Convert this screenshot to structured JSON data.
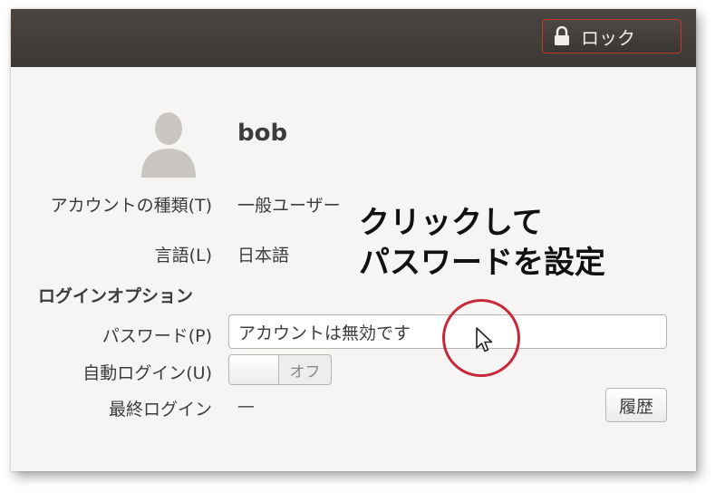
{
  "header": {
    "lock_button": {
      "label": "ロック",
      "icon": "lock-icon"
    }
  },
  "user": {
    "name": "bob",
    "avatar_icon": "user-silhouette-icon"
  },
  "fields": {
    "account_type": {
      "label": "アカウントの種類(T)",
      "value": "一般ユーザー"
    },
    "language": {
      "label": "言語(L)",
      "value": "日本語"
    },
    "login_options_heading": "ログインオプション",
    "password": {
      "label": "パスワード(P)",
      "value": "アカウントは無効です"
    },
    "auto_login": {
      "label": "自動ログイン(U)",
      "state": "オフ"
    },
    "last_login": {
      "label": "最終ログイン",
      "value": "—",
      "history_button": "履歴"
    }
  },
  "annotation": {
    "line1": "クリックして",
    "line2": "パスワードを設定",
    "highlight_color": "#c8283c"
  },
  "colors": {
    "titlebar": "#3c3835",
    "lock_border": "#c0392b",
    "window_bg": "#f6f5f4"
  }
}
